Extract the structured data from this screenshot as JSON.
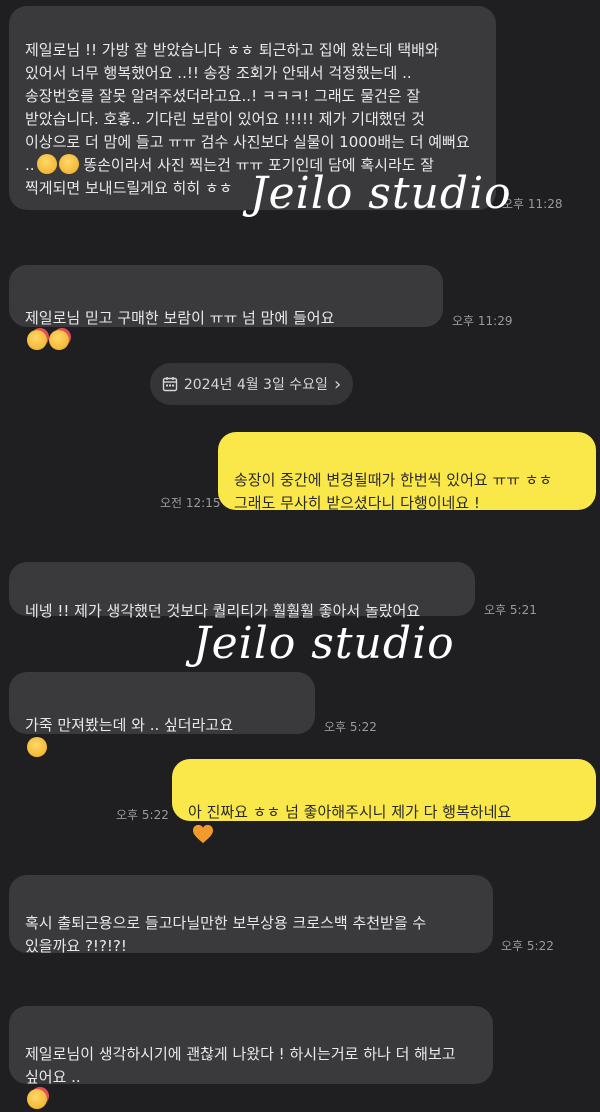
{
  "messages": [
    {
      "text": "제일로님 !! 가방 잘 받았습니다 ㅎㅎ 퇴근하고 집에 왔는데 택배와 있어서 너무 행복했어요 ..!! 송장 조회가 안돼서 걱정했는데 .. 송장번호를 잘못 알려주셨더라고요..! ㅋㅋㅋ! 그래도 물건은 잘 받았습니다. 호홓.. 기다린 보람이 있어요 !!!!! 제가 기대했던 것 이상으로 더 맘에 들고 ㅠㅠ 검수 사진보다 실물이 1000배는 더 예뻐요 ..",
      "text2": "똥손이라서 사진 찍는건 ㅠㅠ 포기인데 담에 혹시라도 잘 찍게되면 보내드릴게요 히히 ㅎㅎ",
      "time": "오후 11:28"
    },
    {
      "text": "제일로님 믿고 구매한 보람이 ㅠㅠ 넘 맘에 들어요",
      "time": "오후 11:29"
    },
    {
      "text": "송장이 중간에 변경될때가 한번씩 있어요 ㅠㅠ ㅎㅎ 그래도 무사히 받으셨다니 다행이네요 !",
      "time": "오전 12:15"
    },
    {
      "text": "네넹 !! 제가 생각했던 것보다 퀄리티가 훨훨훨 좋아서 놀랐어요",
      "time": "오후 5:21"
    },
    {
      "text": "가죽 만져봤는데 와 .. 싶더라고요",
      "time": "오후 5:22"
    },
    {
      "text": "아 진짜요 ㅎㅎ 넘 좋아해주시니 제가 다 행복하네요",
      "time": "오후 5:22"
    },
    {
      "text": "혹시 출퇴근용으로 들고다닐만한 보부상용 크로스백 추천받을 수 있을까요 ?!?!?!",
      "time": "오후 5:22"
    },
    {
      "text": "제일로님이 생각하시기에 괜찮게 나왔다 ! 하시는거로 하나 더 해보고 싶어요 .."
    }
  ],
  "date_divider": "2024년 4월 3일 수요일",
  "date_chevron": "›",
  "watermark": "Jeilo studio",
  "icons": {
    "calendar": "calendar-icon",
    "pleading": "pleading-face-emoji",
    "hearts": "smiling-face-with-hearts-emoji",
    "heart": "orange-heart-emoji"
  },
  "colors": {
    "background": "#1f1f21",
    "incoming": "#3a3a3c",
    "outgoing": "#fae84a",
    "heart": "#f39a2e"
  }
}
